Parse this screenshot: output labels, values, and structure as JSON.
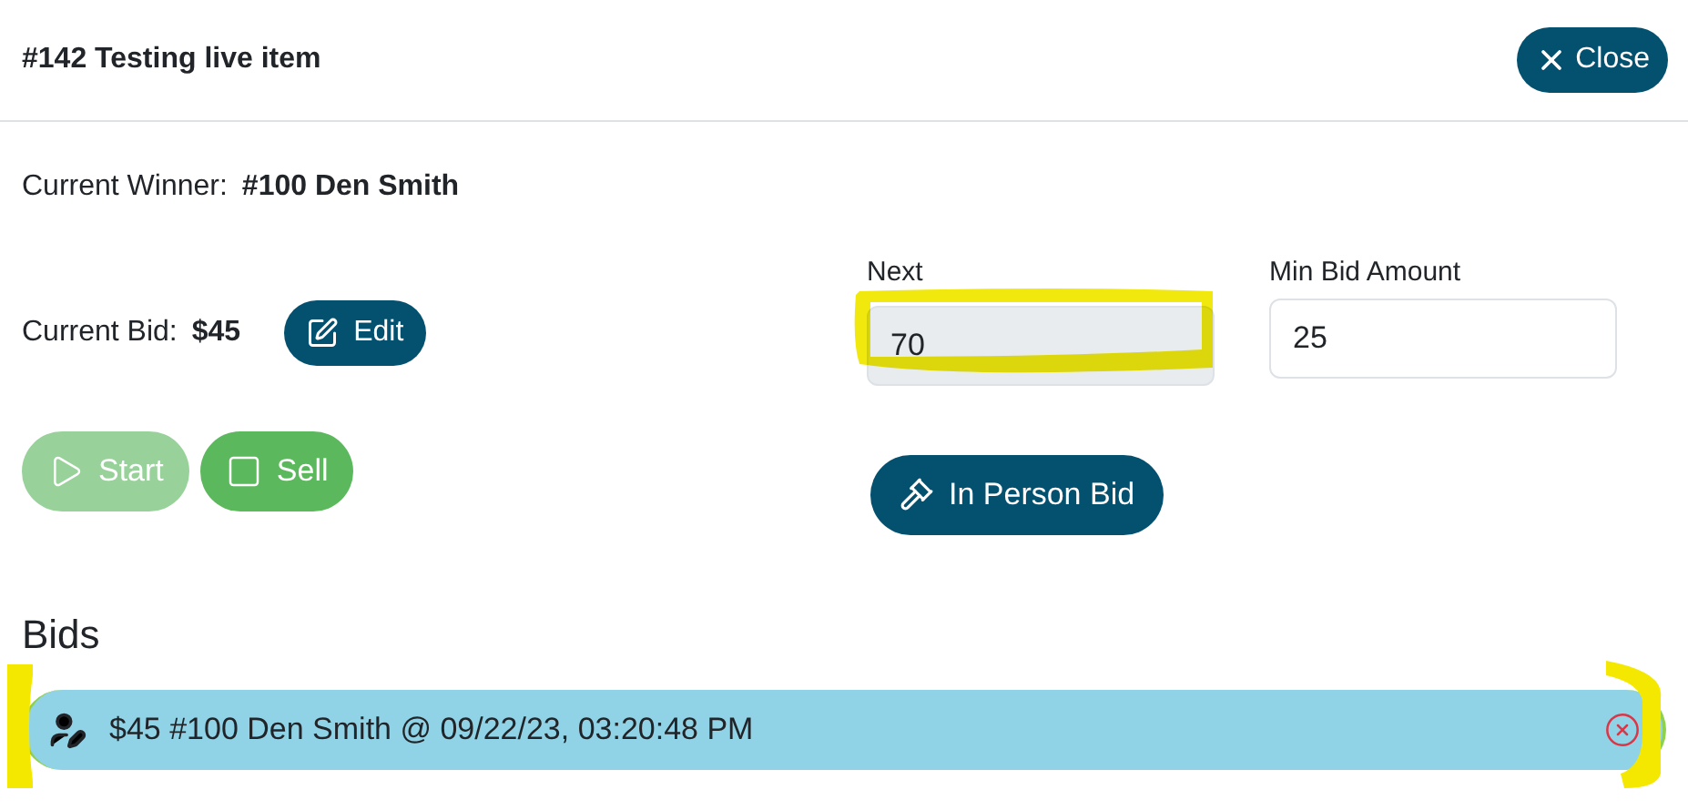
{
  "header": {
    "title": "#142 Testing live item",
    "close_button": "Close"
  },
  "winner": {
    "label": "Current Winner:",
    "value": "#100 Den Smith"
  },
  "current_bid": {
    "label": "Current Bid:",
    "value": "$45",
    "edit_button": "Edit"
  },
  "fields": [
    {
      "label": "Next",
      "value": "70",
      "disabled": true,
      "highlighted": true
    },
    {
      "label": "Min Bid Amount",
      "value": "25",
      "disabled": false,
      "highlighted": false
    }
  ],
  "actions": [
    {
      "kind": "start",
      "label": "Start",
      "disabled": true
    },
    {
      "kind": "sell",
      "label": "Sell",
      "disabled": false
    }
  ],
  "in_person_button": "In Person Bid",
  "bids": {
    "title": "Bids",
    "items": [
      {
        "text": "$45 #100 Den Smith @ 09/22/23, 03:20:48 PM",
        "highlighted": true
      }
    ]
  }
}
